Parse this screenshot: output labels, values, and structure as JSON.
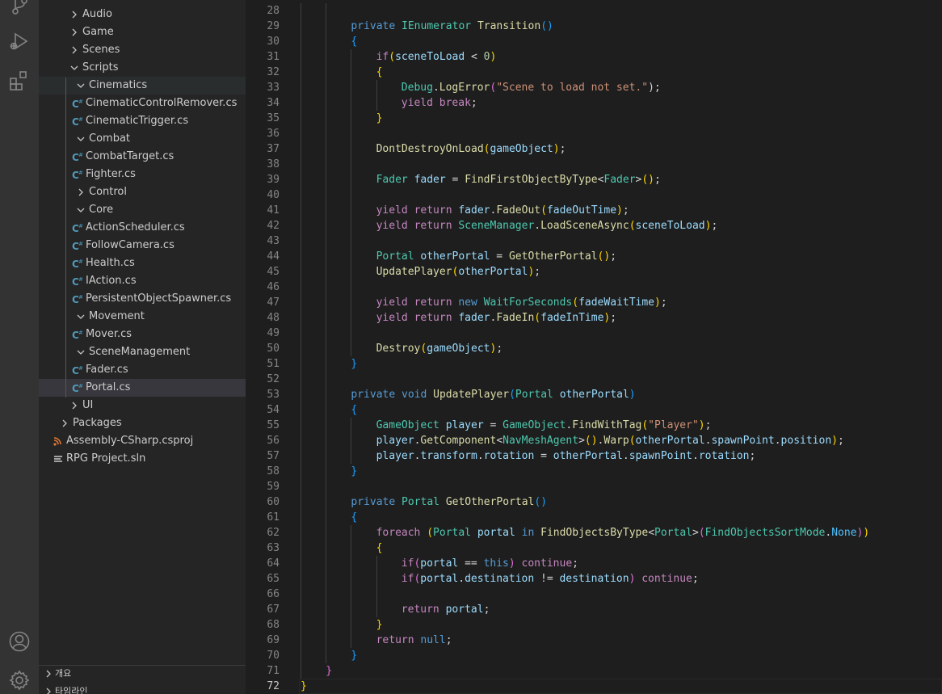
{
  "colors": {
    "keyword": "#569cd6",
    "control": "#c586c0",
    "type": "#4ec9b0",
    "method": "#dcdcaa",
    "variable": "#9cdcfe",
    "string": "#ce9178",
    "number": "#b5cea8",
    "punct": "#d4d4d4",
    "brace1": "#ffd700",
    "brace2": "#da70d6",
    "brace3": "#179fff",
    "constant": "#4fc1ff"
  },
  "activity_bar": [
    {
      "name": "source-control-icon"
    },
    {
      "name": "run-debug-icon"
    },
    {
      "name": "extensions-icon"
    },
    {
      "name": "account-icon"
    },
    {
      "name": "settings-gear-icon"
    }
  ],
  "explorer": {
    "items": [
      {
        "label": "Audio",
        "depth": 1,
        "kind": "folder",
        "open": false
      },
      {
        "label": "Game",
        "depth": 1,
        "kind": "folder",
        "open": false
      },
      {
        "label": "Scenes",
        "depth": 1,
        "kind": "folder",
        "open": false
      },
      {
        "label": "Scripts",
        "depth": 1,
        "kind": "folder",
        "open": true
      },
      {
        "label": "Cinematics",
        "depth": 2,
        "kind": "folder",
        "open": true,
        "state": "highlight"
      },
      {
        "label": "CinematicControlRemover.cs",
        "depth": 3,
        "kind": "cs"
      },
      {
        "label": "CinematicTrigger.cs",
        "depth": 3,
        "kind": "cs"
      },
      {
        "label": "Combat",
        "depth": 2,
        "kind": "folder",
        "open": true
      },
      {
        "label": "CombatTarget.cs",
        "depth": 3,
        "kind": "cs"
      },
      {
        "label": "Fighter.cs",
        "depth": 3,
        "kind": "cs"
      },
      {
        "label": "Control",
        "depth": 2,
        "kind": "folder",
        "open": false
      },
      {
        "label": "Core",
        "depth": 2,
        "kind": "folder",
        "open": true
      },
      {
        "label": "ActionScheduler.cs",
        "depth": 3,
        "kind": "cs"
      },
      {
        "label": "FollowCamera.cs",
        "depth": 3,
        "kind": "cs"
      },
      {
        "label": "Health.cs",
        "depth": 3,
        "kind": "cs"
      },
      {
        "label": "IAction.cs",
        "depth": 3,
        "kind": "cs"
      },
      {
        "label": "PersistentObjectSpawner.cs",
        "depth": 3,
        "kind": "cs"
      },
      {
        "label": "Movement",
        "depth": 2,
        "kind": "folder",
        "open": true
      },
      {
        "label": "Mover.cs",
        "depth": 3,
        "kind": "cs"
      },
      {
        "label": "SceneManagement",
        "depth": 2,
        "kind": "folder",
        "open": true
      },
      {
        "label": "Fader.cs",
        "depth": 3,
        "kind": "cs"
      },
      {
        "label": "Portal.cs",
        "depth": 3,
        "kind": "cs",
        "state": "selected"
      },
      {
        "label": "UI",
        "depth": 1,
        "kind": "folder",
        "open": false
      },
      {
        "label": "Packages",
        "depth": 0,
        "kind": "folder",
        "open": false
      },
      {
        "label": "Assembly-CSharp.csproj",
        "depth": 0,
        "kind": "rss"
      },
      {
        "label": "RPG Project.sln",
        "depth": 0,
        "kind": "sln"
      }
    ]
  },
  "panels": [
    {
      "label": "개요"
    },
    {
      "label": "타임라인"
    }
  ],
  "editor": {
    "current_line": 72,
    "lines": [
      {
        "n": 28,
        "indent": 0,
        "t": []
      },
      {
        "n": 29,
        "indent": 2,
        "t": [
          [
            "private ",
            "keyword"
          ],
          [
            "IEnumerator ",
            "type"
          ],
          [
            "Transition",
            "method"
          ],
          [
            "()",
            "brace3"
          ]
        ]
      },
      {
        "n": 30,
        "indent": 2,
        "t": [
          [
            "{",
            "brace3"
          ]
        ]
      },
      {
        "n": 31,
        "indent": 3,
        "t": [
          [
            "if",
            "control"
          ],
          [
            "(",
            "brace1"
          ],
          [
            "sceneToLoad",
            "variable"
          ],
          [
            " < ",
            "punct"
          ],
          [
            "0",
            "number"
          ],
          [
            ")",
            "brace1"
          ]
        ]
      },
      {
        "n": 32,
        "indent": 3,
        "t": [
          [
            "{",
            "brace1"
          ]
        ]
      },
      {
        "n": 33,
        "indent": 4,
        "t": [
          [
            "Debug",
            "type"
          ],
          [
            ".",
            "punct"
          ],
          [
            "LogError",
            "method"
          ],
          [
            "(",
            "brace2"
          ],
          [
            "\"Scene to load not set.\"",
            "string"
          ],
          [
            ");",
            "punct"
          ]
        ]
      },
      {
        "n": 34,
        "indent": 4,
        "t": [
          [
            "yield ",
            "control"
          ],
          [
            "break",
            "control"
          ],
          [
            ";",
            "punct"
          ]
        ]
      },
      {
        "n": 35,
        "indent": 3,
        "t": [
          [
            "}",
            "brace1"
          ]
        ]
      },
      {
        "n": 36,
        "indent": 0,
        "t": []
      },
      {
        "n": 37,
        "indent": 3,
        "t": [
          [
            "DontDestroyOnLoad",
            "method"
          ],
          [
            "(",
            "brace1"
          ],
          [
            "gameObject",
            "variable"
          ],
          [
            ")",
            "brace1"
          ],
          [
            ";",
            "punct"
          ]
        ]
      },
      {
        "n": 38,
        "indent": 0,
        "t": []
      },
      {
        "n": 39,
        "indent": 3,
        "t": [
          [
            "Fader ",
            "type"
          ],
          [
            "fader",
            "variable"
          ],
          [
            " = ",
            "punct"
          ],
          [
            "FindFirstObjectByType",
            "method"
          ],
          [
            "<",
            "punct"
          ],
          [
            "Fader",
            "type"
          ],
          [
            ">",
            "punct"
          ],
          [
            "()",
            "brace1"
          ],
          [
            ";",
            "punct"
          ]
        ]
      },
      {
        "n": 40,
        "indent": 0,
        "t": []
      },
      {
        "n": 41,
        "indent": 3,
        "t": [
          [
            "yield ",
            "control"
          ],
          [
            "return ",
            "control"
          ],
          [
            "fader",
            "variable"
          ],
          [
            ".",
            "punct"
          ],
          [
            "FadeOut",
            "method"
          ],
          [
            "(",
            "brace1"
          ],
          [
            "fadeOutTime",
            "variable"
          ],
          [
            ")",
            "brace1"
          ],
          [
            ";",
            "punct"
          ]
        ]
      },
      {
        "n": 42,
        "indent": 3,
        "t": [
          [
            "yield ",
            "control"
          ],
          [
            "return ",
            "control"
          ],
          [
            "SceneManager",
            "type"
          ],
          [
            ".",
            "punct"
          ],
          [
            "LoadSceneAsync",
            "method"
          ],
          [
            "(",
            "brace1"
          ],
          [
            "sceneToLoad",
            "variable"
          ],
          [
            ")",
            "brace1"
          ],
          [
            ";",
            "punct"
          ]
        ]
      },
      {
        "n": 43,
        "indent": 0,
        "t": []
      },
      {
        "n": 44,
        "indent": 3,
        "t": [
          [
            "Portal ",
            "type"
          ],
          [
            "otherPortal",
            "variable"
          ],
          [
            " = ",
            "punct"
          ],
          [
            "GetOtherPortal",
            "method"
          ],
          [
            "()",
            "brace1"
          ],
          [
            ";",
            "punct"
          ]
        ]
      },
      {
        "n": 45,
        "indent": 3,
        "t": [
          [
            "UpdatePlayer",
            "method"
          ],
          [
            "(",
            "brace1"
          ],
          [
            "otherPortal",
            "variable"
          ],
          [
            ")",
            "brace1"
          ],
          [
            ";",
            "punct"
          ]
        ]
      },
      {
        "n": 46,
        "indent": 0,
        "t": []
      },
      {
        "n": 47,
        "indent": 3,
        "t": [
          [
            "yield ",
            "control"
          ],
          [
            "return ",
            "control"
          ],
          [
            "new ",
            "keyword"
          ],
          [
            "WaitForSeconds",
            "type"
          ],
          [
            "(",
            "brace1"
          ],
          [
            "fadeWaitTime",
            "variable"
          ],
          [
            ")",
            "brace1"
          ],
          [
            ";",
            "punct"
          ]
        ]
      },
      {
        "n": 48,
        "indent": 3,
        "t": [
          [
            "yield ",
            "control"
          ],
          [
            "return ",
            "control"
          ],
          [
            "fader",
            "variable"
          ],
          [
            ".",
            "punct"
          ],
          [
            "FadeIn",
            "method"
          ],
          [
            "(",
            "brace1"
          ],
          [
            "fadeInTime",
            "variable"
          ],
          [
            ")",
            "brace1"
          ],
          [
            ";",
            "punct"
          ]
        ]
      },
      {
        "n": 49,
        "indent": 0,
        "t": []
      },
      {
        "n": 50,
        "indent": 3,
        "t": [
          [
            "Destroy",
            "method"
          ],
          [
            "(",
            "brace1"
          ],
          [
            "gameObject",
            "variable"
          ],
          [
            ")",
            "brace1"
          ],
          [
            ";",
            "punct"
          ]
        ]
      },
      {
        "n": 51,
        "indent": 2,
        "t": [
          [
            "}",
            "brace3"
          ]
        ]
      },
      {
        "n": 52,
        "indent": 0,
        "t": []
      },
      {
        "n": 53,
        "indent": 2,
        "t": [
          [
            "private ",
            "keyword"
          ],
          [
            "void ",
            "keyword"
          ],
          [
            "UpdatePlayer",
            "method"
          ],
          [
            "(",
            "brace3"
          ],
          [
            "Portal ",
            "type"
          ],
          [
            "otherPortal",
            "variable"
          ],
          [
            ")",
            "brace3"
          ]
        ]
      },
      {
        "n": 54,
        "indent": 2,
        "t": [
          [
            "{",
            "brace3"
          ]
        ]
      },
      {
        "n": 55,
        "indent": 3,
        "t": [
          [
            "GameObject ",
            "type"
          ],
          [
            "player",
            "variable"
          ],
          [
            " = ",
            "punct"
          ],
          [
            "GameObject",
            "type"
          ],
          [
            ".",
            "punct"
          ],
          [
            "FindWithTag",
            "method"
          ],
          [
            "(",
            "brace1"
          ],
          [
            "\"Player\"",
            "string"
          ],
          [
            ")",
            "brace1"
          ],
          [
            ";",
            "punct"
          ]
        ]
      },
      {
        "n": 56,
        "indent": 3,
        "t": [
          [
            "player",
            "variable"
          ],
          [
            ".",
            "punct"
          ],
          [
            "GetComponent",
            "method"
          ],
          [
            "<",
            "punct"
          ],
          [
            "NavMeshAgent",
            "type"
          ],
          [
            ">",
            "punct"
          ],
          [
            "()",
            "brace1"
          ],
          [
            ".",
            "punct"
          ],
          [
            "Warp",
            "method"
          ],
          [
            "(",
            "brace1"
          ],
          [
            "otherPortal",
            "variable"
          ],
          [
            ".",
            "punct"
          ],
          [
            "spawnPoint",
            "variable"
          ],
          [
            ".",
            "punct"
          ],
          [
            "position",
            "variable"
          ],
          [
            ")",
            "brace1"
          ],
          [
            ";",
            "punct"
          ]
        ]
      },
      {
        "n": 57,
        "indent": 3,
        "t": [
          [
            "player",
            "variable"
          ],
          [
            ".",
            "punct"
          ],
          [
            "transform",
            "variable"
          ],
          [
            ".",
            "punct"
          ],
          [
            "rotation",
            "variable"
          ],
          [
            " = ",
            "punct"
          ],
          [
            "otherPortal",
            "variable"
          ],
          [
            ".",
            "punct"
          ],
          [
            "spawnPoint",
            "variable"
          ],
          [
            ".",
            "punct"
          ],
          [
            "rotation",
            "variable"
          ],
          [
            ";",
            "punct"
          ]
        ]
      },
      {
        "n": 58,
        "indent": 2,
        "t": [
          [
            "}",
            "brace3"
          ]
        ]
      },
      {
        "n": 59,
        "indent": 0,
        "t": []
      },
      {
        "n": 60,
        "indent": 2,
        "t": [
          [
            "private ",
            "keyword"
          ],
          [
            "Portal ",
            "type"
          ],
          [
            "GetOtherPortal",
            "method"
          ],
          [
            "()",
            "brace3"
          ]
        ]
      },
      {
        "n": 61,
        "indent": 2,
        "t": [
          [
            "{",
            "brace3"
          ]
        ]
      },
      {
        "n": 62,
        "indent": 3,
        "t": [
          [
            "foreach ",
            "control"
          ],
          [
            "(",
            "brace1"
          ],
          [
            "Portal ",
            "type"
          ],
          [
            "portal",
            "variable"
          ],
          [
            " in ",
            "keyword"
          ],
          [
            "FindObjectsByType",
            "method"
          ],
          [
            "<",
            "punct"
          ],
          [
            "Portal",
            "type"
          ],
          [
            ">",
            "punct"
          ],
          [
            "(",
            "brace2"
          ],
          [
            "FindObjectsSortMode",
            "type"
          ],
          [
            ".",
            "punct"
          ],
          [
            "None",
            "constant"
          ],
          [
            ")",
            "brace2"
          ],
          [
            ")",
            "brace1"
          ]
        ]
      },
      {
        "n": 63,
        "indent": 3,
        "t": [
          [
            "{",
            "brace1"
          ]
        ]
      },
      {
        "n": 64,
        "indent": 4,
        "t": [
          [
            "if",
            "control"
          ],
          [
            "(",
            "brace2"
          ],
          [
            "portal",
            "variable"
          ],
          [
            " == ",
            "punct"
          ],
          [
            "this",
            "keyword"
          ],
          [
            ")",
            "brace2"
          ],
          [
            " continue",
            "control"
          ],
          [
            ";",
            "punct"
          ]
        ]
      },
      {
        "n": 65,
        "indent": 4,
        "t": [
          [
            "if",
            "control"
          ],
          [
            "(",
            "brace2"
          ],
          [
            "portal",
            "variable"
          ],
          [
            ".",
            "punct"
          ],
          [
            "destination",
            "variable"
          ],
          [
            " != ",
            "punct"
          ],
          [
            "destination",
            "variable"
          ],
          [
            ")",
            "brace2"
          ],
          [
            " continue",
            "control"
          ],
          [
            ";",
            "punct"
          ]
        ]
      },
      {
        "n": 66,
        "indent": 0,
        "t": []
      },
      {
        "n": 67,
        "indent": 4,
        "t": [
          [
            "return ",
            "control"
          ],
          [
            "portal",
            "variable"
          ],
          [
            ";",
            "punct"
          ]
        ]
      },
      {
        "n": 68,
        "indent": 3,
        "t": [
          [
            "}",
            "brace1"
          ]
        ]
      },
      {
        "n": 69,
        "indent": 3,
        "t": [
          [
            "return ",
            "control"
          ],
          [
            "null",
            "keyword"
          ],
          [
            ";",
            "punct"
          ]
        ]
      },
      {
        "n": 70,
        "indent": 2,
        "t": [
          [
            "}",
            "brace3"
          ]
        ]
      },
      {
        "n": 71,
        "indent": 1,
        "t": [
          [
            "}",
            "brace2"
          ]
        ]
      },
      {
        "n": 72,
        "indent": 0,
        "t": [
          [
            "}",
            "brace1"
          ]
        ]
      }
    ]
  }
}
